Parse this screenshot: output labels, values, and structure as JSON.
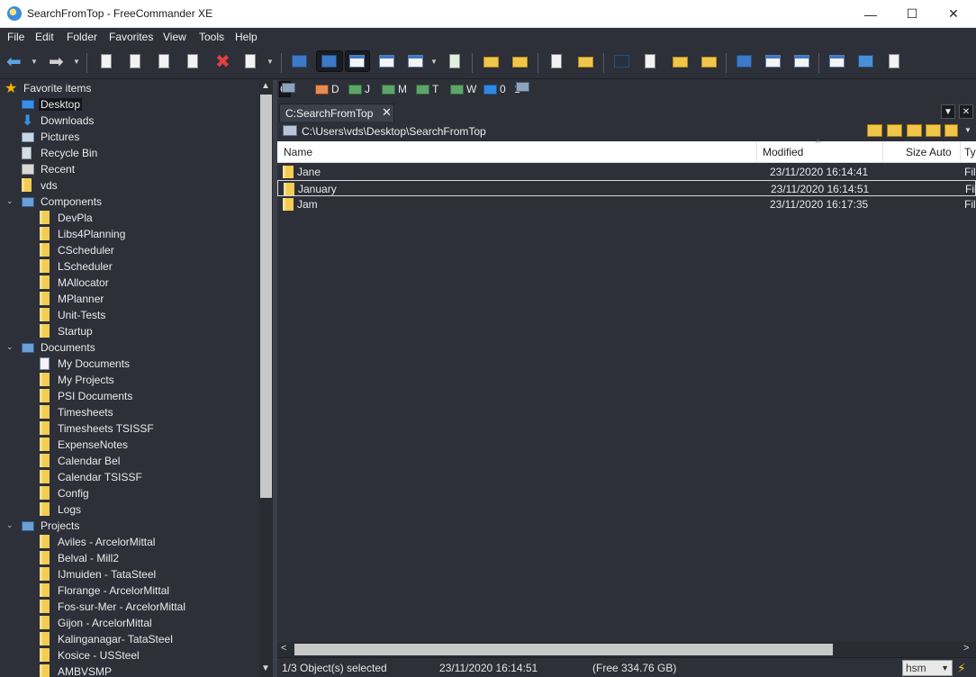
{
  "window": {
    "title": "SearchFromTop - FreeCommander XE",
    "controls": {
      "minimize": "—",
      "maximize": "☐",
      "close": "✕"
    }
  },
  "menu": [
    "File",
    "Edit",
    "Folder",
    "Favorites",
    "View",
    "Tools",
    "Help"
  ],
  "toolbar_icons": [
    "back-arrow-icon",
    "forward-arrow-icon",
    "copy-icon",
    "move-icon",
    "new-file-icon",
    "rename-icon",
    "delete-icon",
    "properties-icon",
    "tree-view-icon",
    "favorites-tree-icon",
    "list-view-icon",
    "dual-pane-icon",
    "dual-pane-alt-icon",
    "refresh-icon",
    "favorite-folder-icon",
    "favorite-folder-remove-icon",
    "new-folder-icon",
    "folder-icon",
    "command-prompt-icon",
    "attributes-icon",
    "export-icon",
    "zip-icon",
    "unzip-icon",
    "sync-icon",
    "split-vertical-icon",
    "split-horizontal-icon",
    "single-pane-icon",
    "link-icon",
    "compare-icon"
  ],
  "tree": [
    {
      "label": "Favorite items",
      "icon": "star-icon",
      "level": 0,
      "twisty": ""
    },
    {
      "label": "Desktop",
      "icon": "desktop-icon",
      "level": 1,
      "twisty": "",
      "selected": true
    },
    {
      "label": "Downloads",
      "icon": "download-icon",
      "level": 1,
      "twisty": ""
    },
    {
      "label": "Pictures",
      "icon": "pictures-icon",
      "level": 1,
      "twisty": ""
    },
    {
      "label": "Recycle Bin",
      "icon": "recycle-bin-icon",
      "level": 1,
      "twisty": ""
    },
    {
      "label": "Recent",
      "icon": "recent-icon",
      "level": 1,
      "twisty": ""
    },
    {
      "label": "vds",
      "icon": "folder-icon",
      "level": 1,
      "twisty": ""
    },
    {
      "label": "Components",
      "icon": "open-folder-icon",
      "level": 1,
      "twisty": "v"
    },
    {
      "label": "DevPla",
      "icon": "folder-icon",
      "level": 2,
      "twisty": ""
    },
    {
      "label": "Libs4Planning",
      "icon": "folder-icon",
      "level": 2,
      "twisty": ""
    },
    {
      "label": "CScheduler",
      "icon": "folder-icon",
      "level": 2,
      "twisty": ""
    },
    {
      "label": "LScheduler",
      "icon": "folder-icon",
      "level": 2,
      "twisty": ""
    },
    {
      "label": "MAllocator",
      "icon": "folder-icon",
      "level": 2,
      "twisty": ""
    },
    {
      "label": "MPlanner",
      "icon": "folder-icon",
      "level": 2,
      "twisty": ""
    },
    {
      "label": "Unit-Tests",
      "icon": "folder-icon",
      "level": 2,
      "twisty": ""
    },
    {
      "label": "Startup",
      "icon": "folder-icon",
      "level": 2,
      "twisty": ""
    },
    {
      "label": "Documents",
      "icon": "open-folder-icon",
      "level": 1,
      "twisty": "v"
    },
    {
      "label": "My Documents",
      "icon": "documents-icon",
      "level": 2,
      "twisty": ""
    },
    {
      "label": "My Projects",
      "icon": "folder-icon",
      "level": 2,
      "twisty": ""
    },
    {
      "label": "PSI Documents",
      "icon": "folder-icon",
      "level": 2,
      "twisty": ""
    },
    {
      "label": "Timesheets",
      "icon": "folder-icon",
      "level": 2,
      "twisty": ""
    },
    {
      "label": "Timesheets TSISSF",
      "icon": "folder-icon",
      "level": 2,
      "twisty": ""
    },
    {
      "label": "ExpenseNotes",
      "icon": "folder-icon",
      "level": 2,
      "twisty": ""
    },
    {
      "label": "Calendar Bel",
      "icon": "folder-icon",
      "level": 2,
      "twisty": ""
    },
    {
      "label": "Calendar TSISSF",
      "icon": "folder-icon",
      "level": 2,
      "twisty": ""
    },
    {
      "label": "Config",
      "icon": "folder-icon",
      "level": 2,
      "twisty": ""
    },
    {
      "label": "Logs",
      "icon": "folder-icon",
      "level": 2,
      "twisty": ""
    },
    {
      "label": "Projects",
      "icon": "open-folder-icon",
      "level": 1,
      "twisty": "v"
    },
    {
      "label": "Aviles - ArcelorMittal",
      "icon": "folder-icon",
      "level": 2,
      "twisty": ""
    },
    {
      "label": "Belval - Mill2",
      "icon": "folder-icon",
      "level": 2,
      "twisty": ""
    },
    {
      "label": "IJmuiden - TataSteel",
      "icon": "folder-icon",
      "level": 2,
      "twisty": ""
    },
    {
      "label": "Florange - ArcelorMittal",
      "icon": "folder-icon",
      "level": 2,
      "twisty": ""
    },
    {
      "label": "Fos-sur-Mer - ArcelorMittal",
      "icon": "folder-icon",
      "level": 2,
      "twisty": ""
    },
    {
      "label": "Gijon - ArcelorMittal",
      "icon": "folder-icon",
      "level": 2,
      "twisty": ""
    },
    {
      "label": "Kalinganagar- TataSteel",
      "icon": "folder-icon",
      "level": 2,
      "twisty": ""
    },
    {
      "label": "Kosice - USSteel",
      "icon": "folder-icon",
      "level": 2,
      "twisty": ""
    },
    {
      "label": "AMBVSMP",
      "icon": "folder-icon",
      "level": 2,
      "twisty": ""
    }
  ],
  "drives": [
    {
      "label": "C",
      "icon": "drive-c-icon",
      "kind": "drive",
      "selected": true
    },
    {
      "label": "D",
      "icon": "drive-d-icon",
      "kind": "book"
    },
    {
      "label": "J",
      "icon": "network-drive-icon",
      "kind": "net"
    },
    {
      "label": "M",
      "icon": "network-drive-icon",
      "kind": "net"
    },
    {
      "label": "T",
      "icon": "network-drive-icon",
      "kind": "net"
    },
    {
      "label": "W",
      "icon": "network-drive-icon",
      "kind": "net"
    },
    {
      "label": "0",
      "icon": "monitor-icon",
      "kind": "mon"
    },
    {
      "label": "1",
      "icon": "network-icon",
      "kind": "drive"
    }
  ],
  "tab": {
    "label": "C:SearchFromTop",
    "close": "✕"
  },
  "tab_controls": {
    "dropdown": "▼",
    "close": "✕"
  },
  "path": "C:\\Users\\vds\\Desktop\\SearchFromTop",
  "columns": {
    "name": "Name",
    "modified": "Modified",
    "size": "Size Auto",
    "type": "Ty",
    "sort_indicator": "^"
  },
  "files": [
    {
      "name": "Jane",
      "modified": "23/11/2020 16:14:41",
      "type": "Fil"
    },
    {
      "name": "January",
      "modified": "23/11/2020 16:14:51",
      "type": "Fil",
      "focused": true
    },
    {
      "name": "Jam",
      "modified": "23/11/2020 16:17:35",
      "type": "Fil"
    }
  ],
  "status": {
    "selection": "1/3 Object(s) selected",
    "date": "23/11/2020 16:14:51",
    "free": "(Free 334.76 GB)",
    "filter_value": "hsm"
  }
}
